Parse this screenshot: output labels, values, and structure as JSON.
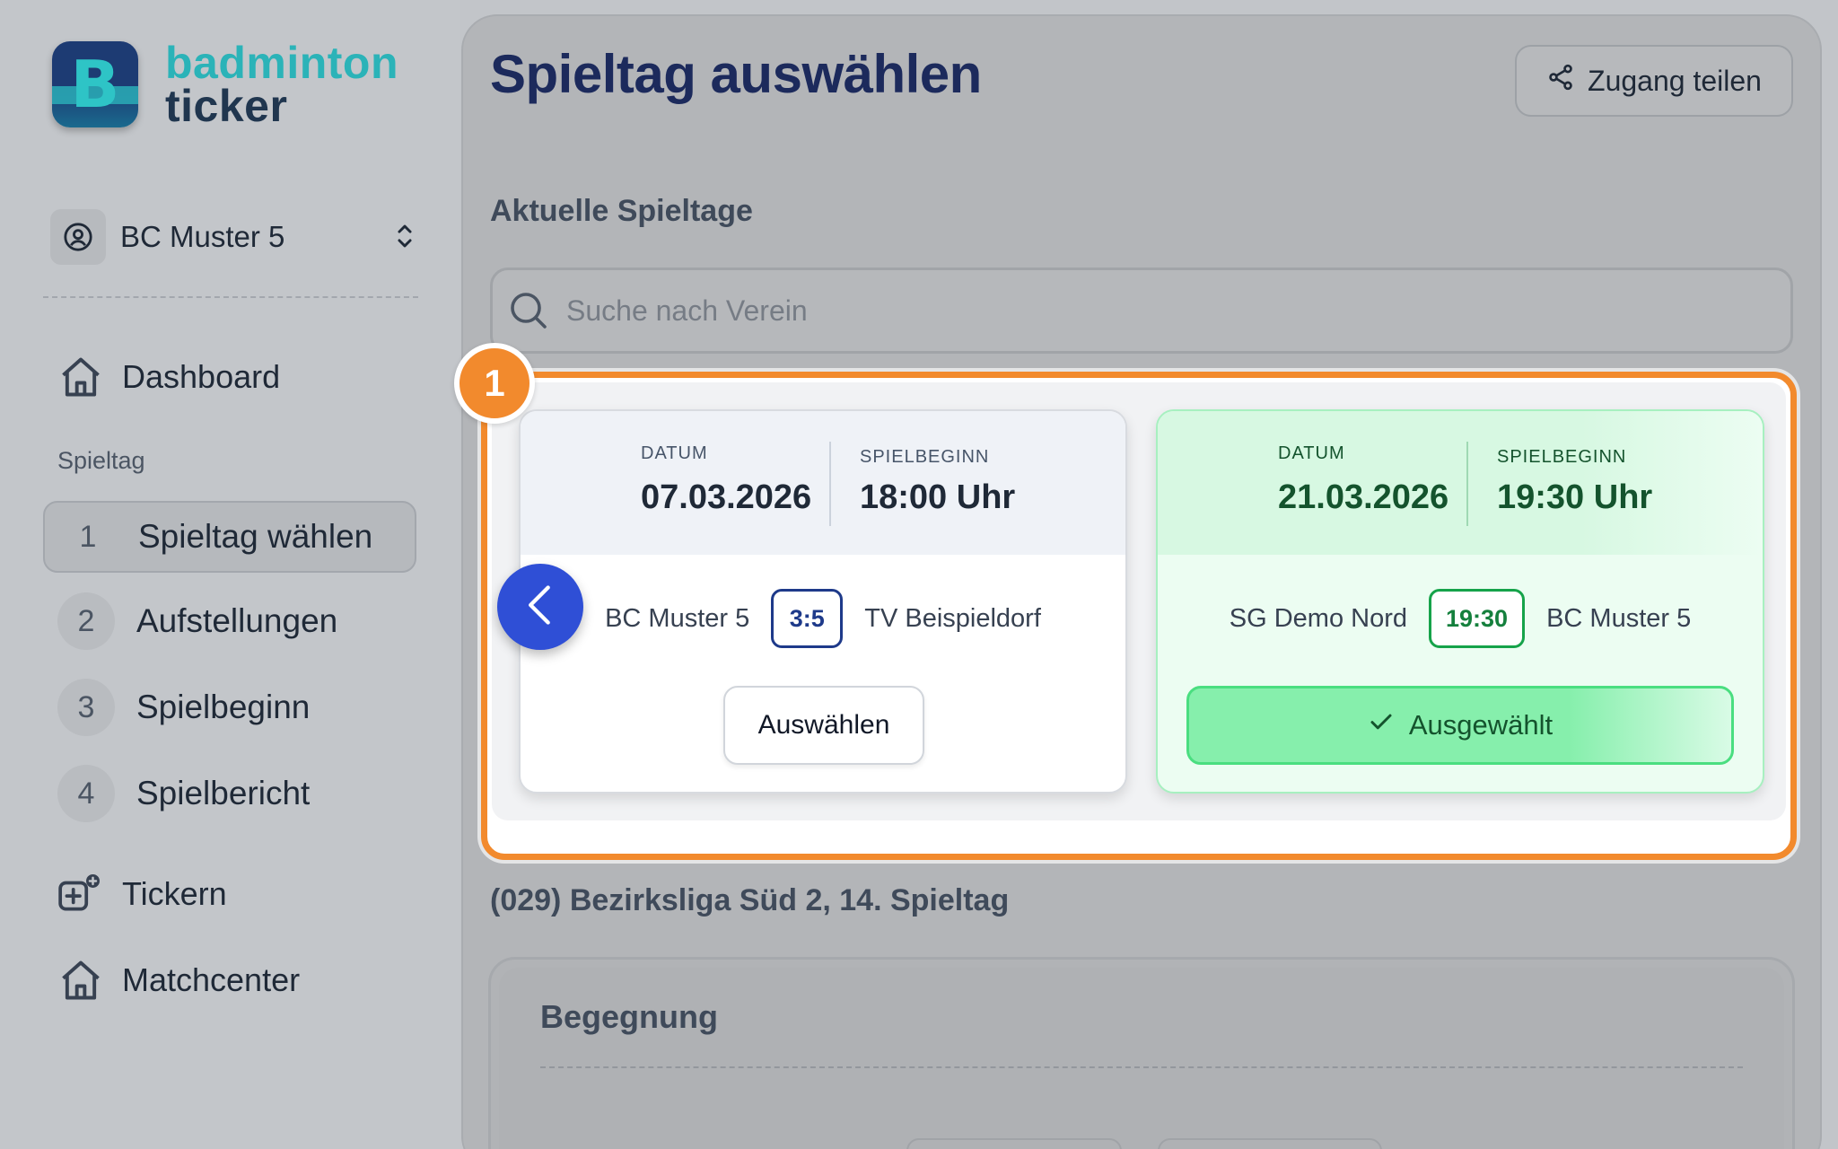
{
  "brand": {
    "line1": "badminton",
    "line2": "ticker",
    "letter": "B"
  },
  "sidebar": {
    "team": {
      "name": "BC Muster 5",
      "icon": "user-circle-icon"
    },
    "items": [
      {
        "label": "Dashboard",
        "icon": "home-icon"
      }
    ],
    "section_label": "Spieltag",
    "steps": [
      {
        "num": "1",
        "label": "Spieltag wählen",
        "active": true
      },
      {
        "num": "2",
        "label": "Aufstellungen",
        "active": false
      },
      {
        "num": "3",
        "label": "Spielbeginn",
        "active": false
      },
      {
        "num": "4",
        "label": "Spielbericht",
        "active": false
      }
    ],
    "extra_items": [
      {
        "label": "Tickern",
        "icon": "add-ticker-icon"
      },
      {
        "label": "Matchcenter",
        "icon": "home-icon"
      }
    ]
  },
  "header": {
    "title": "Spieltag auswählen",
    "share_label": "Zugang teilen"
  },
  "main": {
    "subhead": "Aktuelle Spieltage",
    "search_placeholder": "Suche nach Verein",
    "callout_number": "1",
    "cards": [
      {
        "date_label": "DATUM",
        "date": "07.03.2026",
        "start_label": "SPIELBEGINN",
        "start": "18:00 Uhr",
        "home": "BC Muster 5",
        "score": "3:5",
        "away": "TV Beispieldorf",
        "button": "Auswählen",
        "selected": false
      },
      {
        "date_label": "DATUM",
        "date": "21.03.2026",
        "start_label": "SPIELBEGINN",
        "start": "19:30 Uhr",
        "home": "SG Demo Nord",
        "score": "19:30",
        "away": "BC Muster 5",
        "button": "Ausgewählt",
        "selected": true
      }
    ],
    "league": "(029) Bezirksliga Süd 2, 14. Spieltag",
    "encounter_title": "Begegnung"
  },
  "colors": {
    "accent_orange": "#f28a2d",
    "primary_blue": "#2f4fd6",
    "title_navy": "#1c2a5c",
    "selected_green": "#86efac"
  }
}
